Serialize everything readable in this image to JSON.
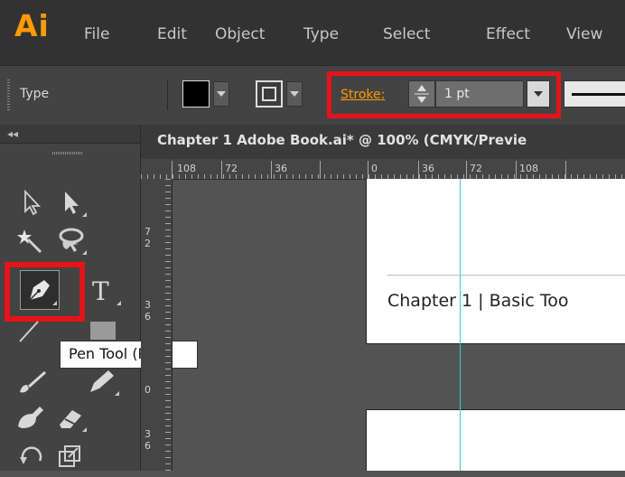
{
  "app": {
    "logo": "Ai",
    "accent": "#ff9a00",
    "highlight": "#e3141a",
    "guide_color": "#39c9d7"
  },
  "menu": {
    "items": [
      "File",
      "Edit",
      "Object",
      "Type",
      "Select",
      "Effect",
      "View"
    ]
  },
  "control_bar": {
    "type_label": "Type",
    "stroke_label": "Stroke:",
    "stroke_value": "1 pt",
    "fill_color": "#000000"
  },
  "document": {
    "title": "Chapter 1 Adobe Book.ai* @ 100% (CMYK/Previe"
  },
  "rulers": {
    "h_labels": [
      "108",
      "72",
      "36",
      "0",
      "36",
      "72",
      "108"
    ],
    "v_labels": [
      "7",
      "2",
      "3",
      "6",
      "0",
      "3",
      "6"
    ]
  },
  "toolbox": {
    "collapse": "◂◂",
    "tools": [
      "selection-tool",
      "direct-selection-tool",
      "magic-wand-tool",
      "lasso-tool",
      "pen-tool",
      "type-tool",
      "line-tool",
      "rectangle-tool",
      "paintbrush-tool",
      "pencil-tool",
      "blob-brush-tool",
      "eraser-tool",
      "rotate-tool",
      "scale-tool"
    ],
    "tooltip": "Pen Tool (P)"
  },
  "canvas": {
    "heading": "Chapter 1 | Basic Too"
  }
}
